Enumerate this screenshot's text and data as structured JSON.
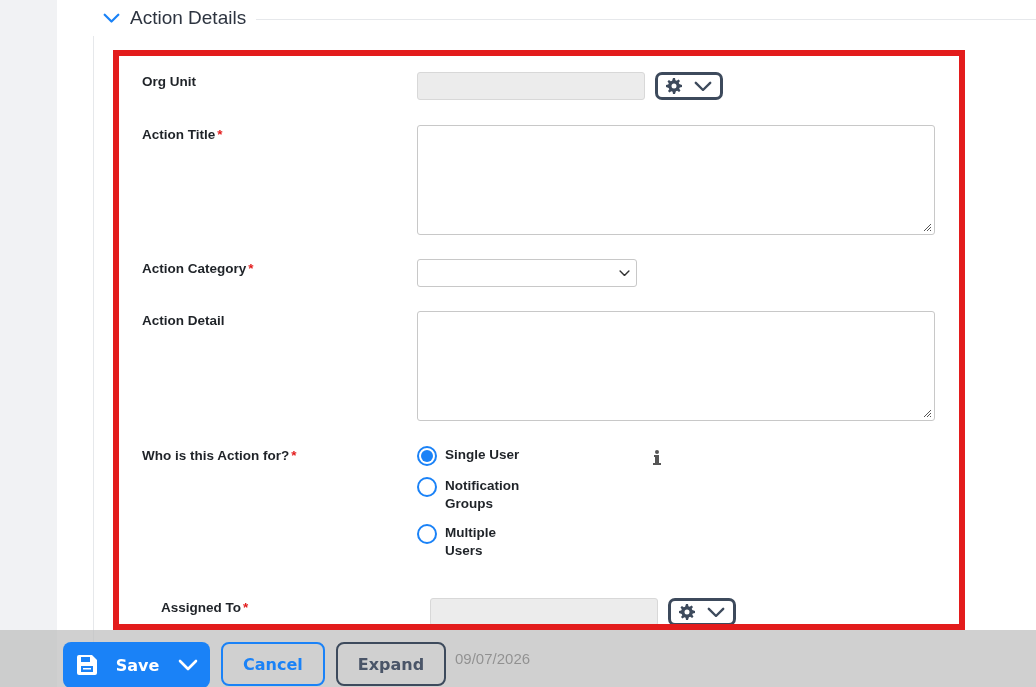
{
  "section": {
    "title": "Action Details",
    "expanded": true
  },
  "required_mark": "*",
  "fields": [
    {
      "kind": "readonly-picker",
      "label": "Org Unit",
      "required": false
    },
    {
      "kind": "textarea",
      "label": "Action Title",
      "required": true
    },
    {
      "kind": "select",
      "label": "Action Category",
      "required": true
    },
    {
      "kind": "textarea",
      "label": "Action Detail",
      "required": false
    },
    {
      "kind": "radio",
      "label": "Who is this Action for?",
      "required": true,
      "options": [
        {
          "label": "Single User",
          "selected": true
        },
        {
          "label": "Notification Groups",
          "selected": false
        },
        {
          "label": "Multiple Users",
          "selected": false
        }
      ]
    }
  ],
  "assigned_to": {
    "label": "Assigned To",
    "required": true
  },
  "date_value": "09/07/2026",
  "actions": [
    {
      "kind": "primary-split",
      "label": "Save"
    },
    {
      "kind": "outline-blue",
      "label": "Cancel"
    },
    {
      "kind": "outline-dark",
      "label": "Expand"
    }
  ]
}
